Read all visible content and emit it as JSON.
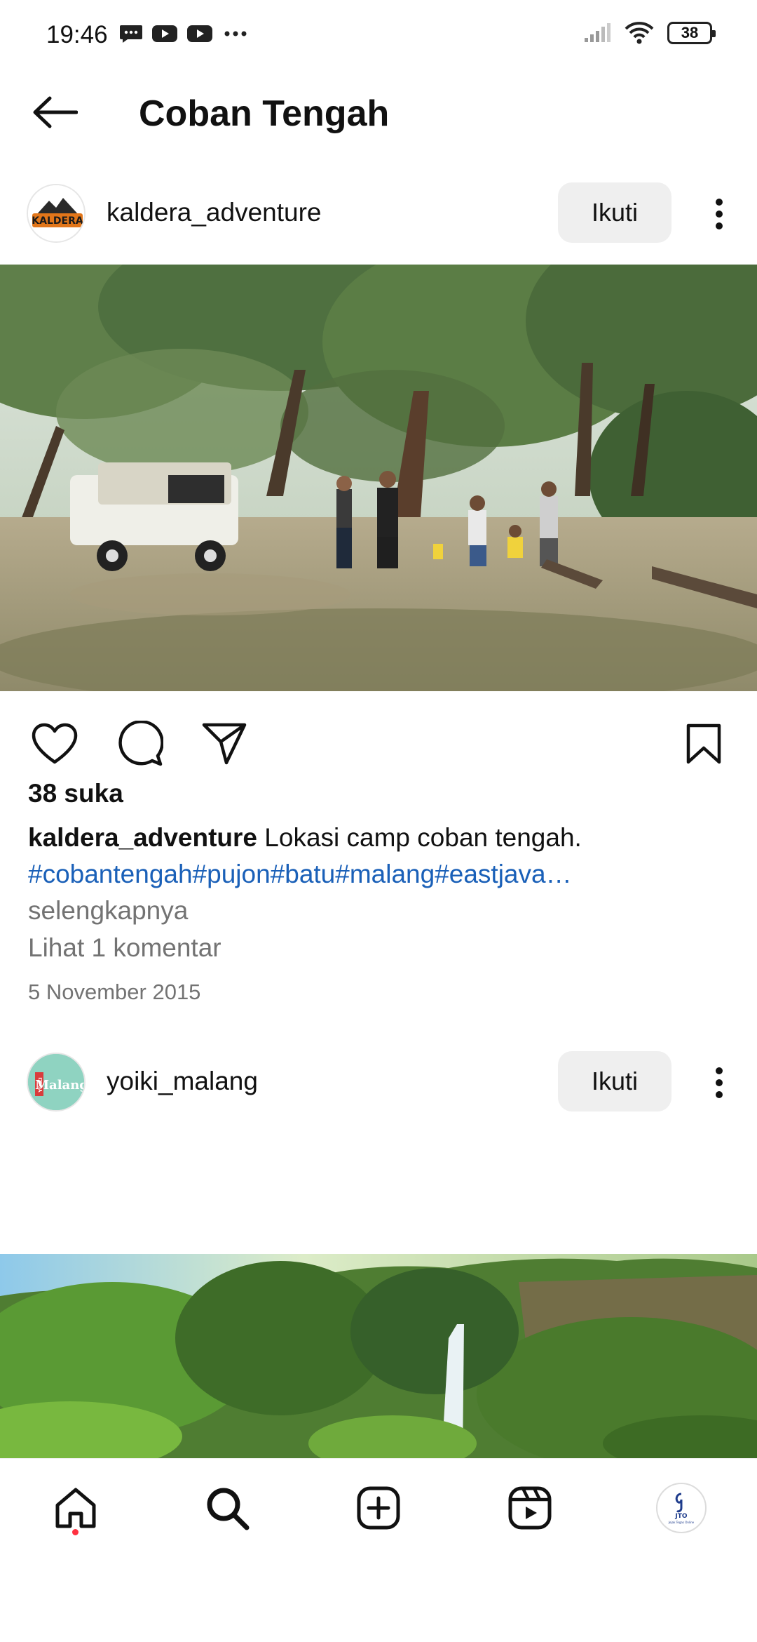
{
  "status_bar": {
    "time": "19:46",
    "battery": "38"
  },
  "header": {
    "title": "Coban Tengah"
  },
  "post1": {
    "username": "kaldera_adventure",
    "avatar_text": "KALDERA",
    "follow_label": "Ikuti",
    "likes": "38 suka",
    "caption_user": "kaldera_adventure",
    "caption_text": " Lokasi camp coban tengah.",
    "hashtags": "#cobantengah#pujon#batu#malang#eastjava…",
    "more_label": "selengkapnya",
    "comments_link": "Lihat 1 komentar",
    "date": "5 November 2015"
  },
  "post2": {
    "username": "yoiki_malang",
    "avatar_text": "Malang",
    "avatar_small_text": "YOIKI",
    "follow_label": "Ikuti"
  },
  "bottom_nav": {
    "avatar_text": "JTO",
    "avatar_subtext": "Jejak Tegas Online"
  },
  "colors": {
    "link": "#1a60b8",
    "muted": "#737373",
    "button_bg": "#efefef",
    "notification_dot": "#ff3040"
  },
  "icons": [
    "back-arrow-icon",
    "heart-icon",
    "comment-icon",
    "share-icon",
    "bookmark-icon",
    "more-vertical-icon",
    "home-icon",
    "search-icon",
    "add-icon",
    "reels-icon"
  ]
}
